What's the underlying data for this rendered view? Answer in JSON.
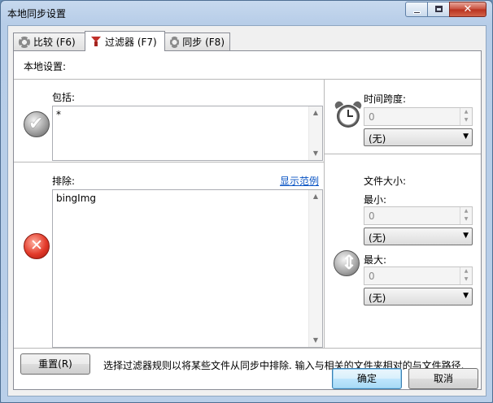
{
  "window": {
    "title": "本地同步设置"
  },
  "tabs": [
    {
      "label": "比较 (F6)",
      "icon": "gear-icon"
    },
    {
      "label": "过滤器 (F7)",
      "icon": "funnel-icon"
    },
    {
      "label": "同步 (F8)",
      "icon": "gear-icon"
    }
  ],
  "panel": {
    "local_settings_label": "本地设置:",
    "include": {
      "label": "包括:",
      "value": "*"
    },
    "exclude": {
      "label": "排除:",
      "value": "bingImg",
      "show_examples_link": "显示范例"
    },
    "timespan": {
      "label": "时间跨度:",
      "value": "0",
      "unit": "(无)"
    },
    "filesize": {
      "label": "文件大小:",
      "min": {
        "label": "最小:",
        "value": "0",
        "unit": "(无)"
      },
      "max": {
        "label": "最大:",
        "value": "0",
        "unit": "(无)"
      }
    }
  },
  "footer": {
    "reset_label": "重置(R)",
    "hint": "选择过滤器规则以将某些文件从同步中排除. 输入与相关的文件夹相对的与文件路径.",
    "ok_label": "确定",
    "cancel_label": "取消"
  }
}
